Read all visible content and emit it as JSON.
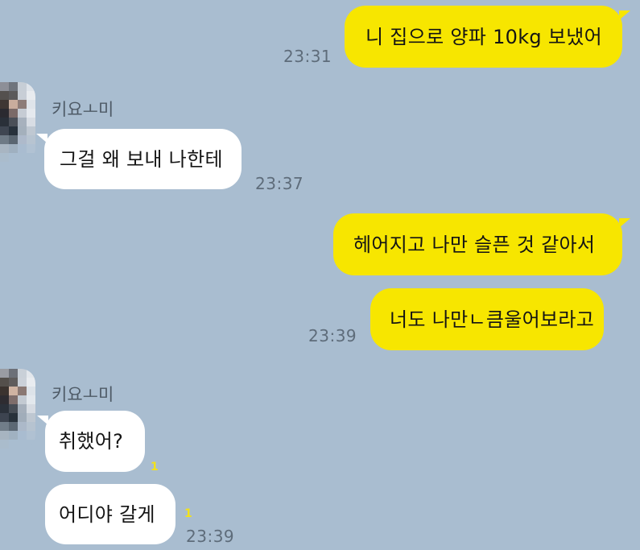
{
  "conversation": {
    "messages": [
      {
        "id": "m1",
        "from": "me",
        "text": "니 집으로 양파 10kg 보냈어",
        "time": "23:31"
      },
      {
        "id": "m2",
        "from": "them",
        "sender": "키요ㅗ미",
        "text": "그걸 왜 보내 나한테",
        "time": "23:37"
      },
      {
        "id": "m3",
        "from": "me",
        "text": "헤어지고 나만 슬픈 것 같아서"
      },
      {
        "id": "m4",
        "from": "me",
        "text": "너도 나만ㄴ큼울어보라고",
        "time": "23:39"
      },
      {
        "id": "m5",
        "from": "them",
        "sender": "키요ㅗ미",
        "text": "취했어?",
        "unread": "1"
      },
      {
        "id": "m6",
        "from": "them",
        "text": "어디야 갈게",
        "unread": "1",
        "time": "23:39"
      }
    ]
  },
  "colors": {
    "background": "#a9bdd0",
    "my_bubble": "#f7e600",
    "their_bubble": "#ffffff",
    "timestamp": "#5e6c7a",
    "unread_count": "#f3e21a"
  },
  "icons": {
    "avatar": "pixelated-avatar-icon"
  }
}
